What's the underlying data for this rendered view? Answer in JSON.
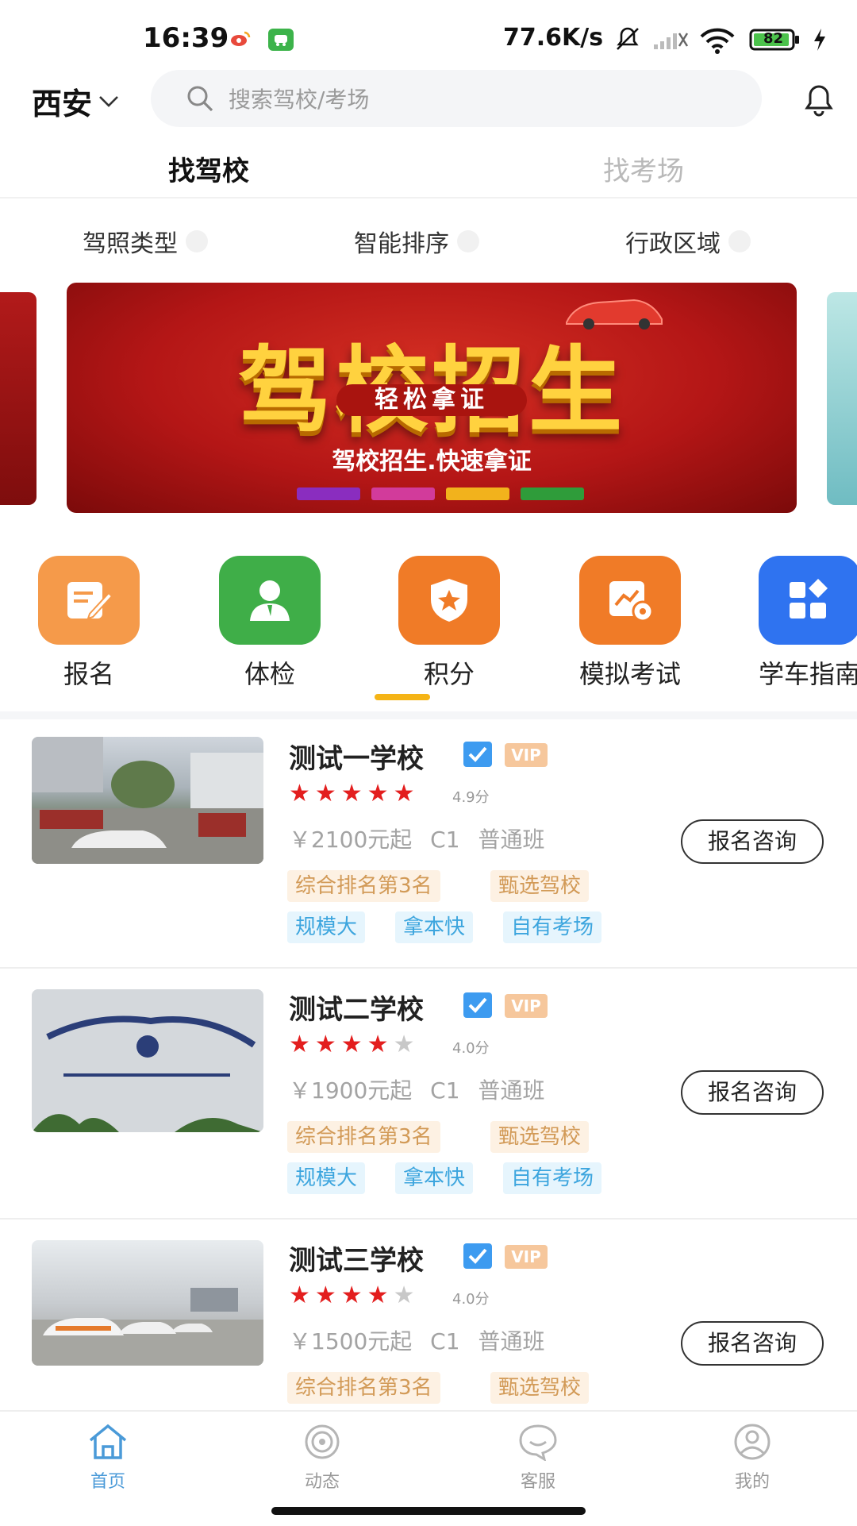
{
  "status_bar": {
    "time": "16:39",
    "net_speed": "77.6K/s",
    "battery": "82"
  },
  "header": {
    "city": "西安",
    "search_placeholder": "搜索驾校/考场"
  },
  "tabs": [
    {
      "label": "找驾校",
      "active": true
    },
    {
      "label": "找考场",
      "active": false
    }
  ],
  "filters": [
    "驾照类型",
    "智能排序",
    "行政区域"
  ],
  "banner": {
    "title": "驾校招生",
    "slogan": "轻松拿证",
    "subtitle": "驾校招生.快速拿证"
  },
  "quick_menu": [
    {
      "label": "报名",
      "icon": "edit-form-icon",
      "color": "#f59a4a"
    },
    {
      "label": "体检",
      "icon": "person-icon",
      "color": "#3fae48"
    },
    {
      "label": "积分",
      "icon": "shield-star-icon",
      "color": "#f07b27"
    },
    {
      "label": "模拟考试",
      "icon": "exam-chart-icon",
      "color": "#f07b27"
    },
    {
      "label": "学车指南",
      "icon": "grid-apps-icon",
      "color": "#2f73f0"
    }
  ],
  "schools": [
    {
      "name": "测试一学校",
      "vip": "VIP",
      "stars_on": 5,
      "score": "4.9分",
      "price": "￥2100元起",
      "license": "C1",
      "class": "普通班",
      "button": "报名咨询",
      "tags_orange": [
        "综合排名第3名",
        "甄选驾校"
      ],
      "tags_blue": [
        "规模大",
        "拿本快",
        "自有考场"
      ]
    },
    {
      "name": "测试二学校",
      "vip": "VIP",
      "stars_on": 4,
      "score": "4.0分",
      "price": "￥1900元起",
      "license": "C1",
      "class": "普通班",
      "button": "报名咨询",
      "tags_orange": [
        "综合排名第3名",
        "甄选驾校"
      ],
      "tags_blue": [
        "规模大",
        "拿本快",
        "自有考场"
      ]
    },
    {
      "name": "测试三学校",
      "vip": "VIP",
      "stars_on": 4,
      "score": "4.0分",
      "price": "￥1500元起",
      "license": "C1",
      "class": "普通班",
      "button": "报名咨询",
      "tags_orange": [
        "综合排名第3名",
        "甄选驾校"
      ],
      "tags_blue": []
    }
  ],
  "bottom_nav": [
    {
      "label": "首页",
      "icon": "home-icon",
      "active": true
    },
    {
      "label": "动态",
      "icon": "feed-icon",
      "active": false
    },
    {
      "label": "客服",
      "icon": "chat-icon",
      "active": false
    },
    {
      "label": "我的",
      "icon": "profile-icon",
      "active": false
    }
  ],
  "colors": {
    "accent": "#4a9ad8",
    "star": "#e31e1e",
    "indicator": "#f5b416"
  }
}
